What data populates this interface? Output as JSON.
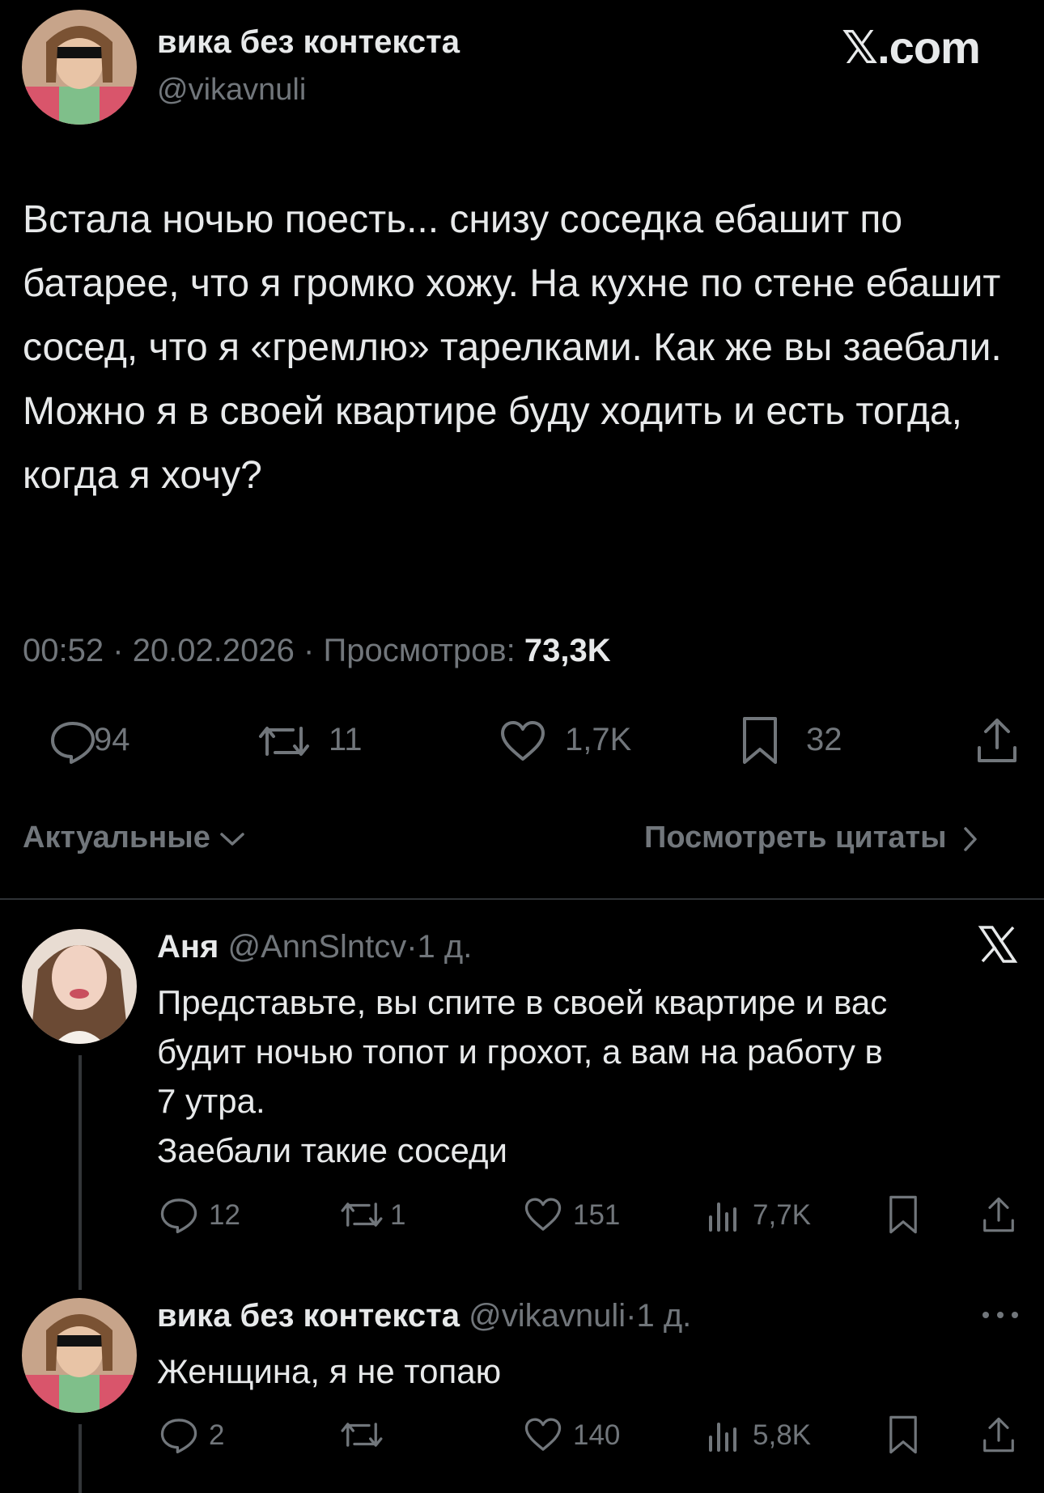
{
  "post": {
    "author_name": "вика без контекста",
    "author_handle": "@vikavnuli",
    "site_logo": "𝕏.com",
    "text": "Встала ночью поесть... снизу соседка ебашит по батарее, что я громко хожу. На кухне по стене ебашит сосед, что я «гремлю» тарелками. Как же вы заебали. Можно я в своей квартире буду ходить и есть тогда, когда я хочу?",
    "time": "00:52",
    "date": "20.02.2026",
    "views_label": "Просмотров:",
    "views_value": "73,3K",
    "dot": "·",
    "stats": {
      "replies": "94",
      "reposts": "11",
      "likes": "1,7K",
      "bookmarks": "32"
    }
  },
  "sort": {
    "label": "Актуальные",
    "quotes_label": "Посмотреть цитаты"
  },
  "replies": [
    {
      "name": "Аня",
      "handle": "@AnnSlntcv",
      "age": "1 д.",
      "dot": "·",
      "lines": [
        "Представьте, вы спите в своей квартире и вас",
        "будит ночью топот и грохот, а вам на работу в",
        "7 утра.",
        "Заебали такие соседи"
      ],
      "stats": {
        "replies": "12",
        "reposts": "1",
        "likes": "151",
        "views": "7,7K"
      }
    },
    {
      "name": "вика без контекста",
      "handle": "@vikavnuli",
      "age": "1 д.",
      "dot": "·",
      "lines": [
        "Женщина, я не топаю"
      ],
      "stats": {
        "replies": "2",
        "reposts": "",
        "likes": "140",
        "views": "5,8K"
      }
    }
  ],
  "colors": {
    "background": "#000000",
    "text": "#e7e9ea",
    "muted": "#71767b",
    "divider": "#2f3336"
  },
  "icons": [
    "reply-icon",
    "repost-icon",
    "like-icon",
    "bookmark-icon",
    "share-icon",
    "views-icon",
    "x-logo-icon",
    "more-icon",
    "chevron-down-icon",
    "chevron-right-icon"
  ]
}
